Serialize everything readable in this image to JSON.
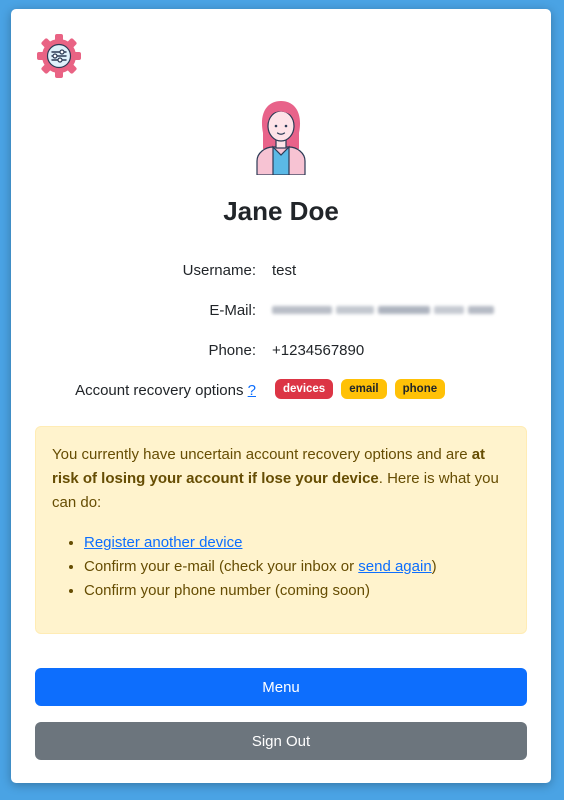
{
  "logo": {
    "icon": "settings-gear-icon",
    "color": "#e96384"
  },
  "profile": {
    "avatar_icon": "female-user-avatar-icon",
    "name": "Jane Doe"
  },
  "fields": {
    "username_label": "Username:",
    "username_value": "test",
    "email_label": "E-Mail:",
    "email_value": "",
    "phone_label": "Phone:",
    "phone_value": "+1234567890",
    "recovery_label": "Account recovery options",
    "recovery_help": "?"
  },
  "badges": [
    {
      "label": "devices",
      "color": "#dc3545"
    },
    {
      "label": "email",
      "color": "#ffc107"
    },
    {
      "label": "phone",
      "color": "#ffc107"
    }
  ],
  "alert": {
    "text_1": "You currently have uncertain account recovery options and are ",
    "text_bold": "at risk of losing your account if lose your device",
    "text_2": ". Here is what you can do:",
    "item_1_link": "Register another device",
    "item_2_text_a": "Confirm your e-mail (check your inbox or ",
    "item_2_link": "send again",
    "item_2_text_b": ")",
    "item_3_text": "Confirm your phone number (coming soon)"
  },
  "buttons": {
    "menu_label": "Menu",
    "signout_label": "Sign Out"
  },
  "colors": {
    "background": "#4aa3e4",
    "primary": "#0d6efd",
    "secondary": "#6c757d",
    "warning_bg": "#fff3cd",
    "warning_text": "#664d03"
  }
}
